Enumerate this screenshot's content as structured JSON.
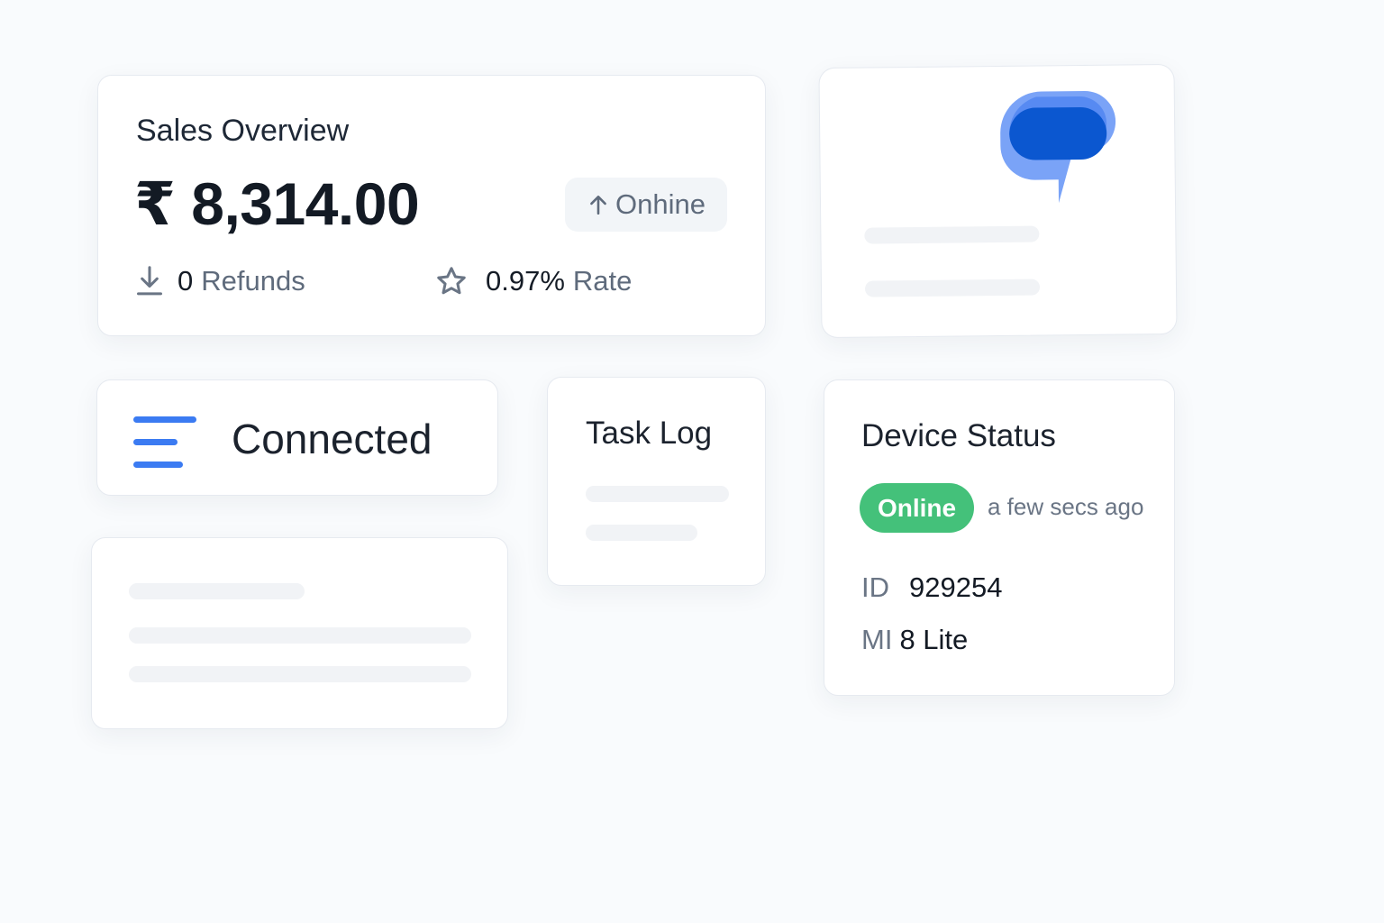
{
  "sales": {
    "title": "Sales Overview",
    "amount": "₹ 8,314.00",
    "status_label": "Onhine",
    "refunds_count": "0",
    "refunds_label": "Refunds",
    "rate_value": "0.97%",
    "rate_label": "Rate"
  },
  "connection": {
    "label": "Connected"
  },
  "task_log": {
    "title": "Task Log"
  },
  "device": {
    "title": "Device Status",
    "status": "Online",
    "last_seen": "a few secs ago",
    "id_label": "ID",
    "id_value": "929254",
    "model_prefix": "MI",
    "model_value": "8 Lite"
  },
  "icons": {
    "status_arrow": "arrow-up-icon",
    "refunds": "download-icon",
    "rate": "star-icon",
    "chat": "chat-bubble-icon",
    "connection": "menu-lines-icon"
  },
  "colors": {
    "accent": "#3b7bf2",
    "chat_bubble_dark": "#0b57d0",
    "chat_bubble_light": "#7aa3f7",
    "online": "#44c17a",
    "muted_text": "#5f6b7c",
    "skeleton": "#f1f3f6"
  }
}
